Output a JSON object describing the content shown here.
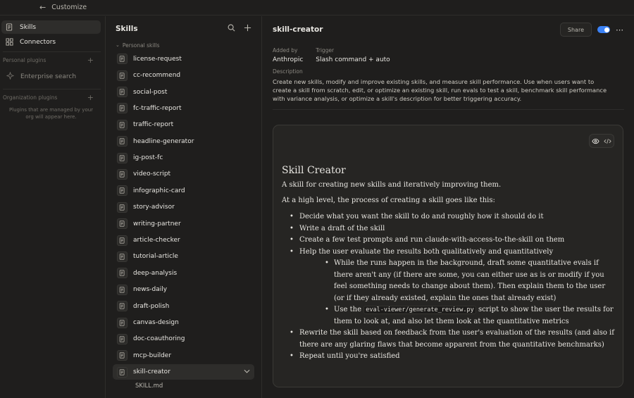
{
  "topbar": {
    "back_icon": "arrow-left-icon",
    "title": "Customize"
  },
  "leftnav": {
    "items": [
      {
        "label": "Skills",
        "icon": "skill-icon",
        "active": true
      },
      {
        "label": "Connectors",
        "icon": "connector-icon",
        "active": false
      }
    ],
    "personal_plugins": "Personal plugins",
    "enterprise_search": "Enterprise search",
    "organization_plugins": "Organization plugins",
    "org_note": "Plugins that are managed by your org will appear here."
  },
  "skills": {
    "title": "Skills",
    "section": "Personal skills",
    "items": [
      "license-request",
      "cc-recommend",
      "social-post",
      "fc-traffic-report",
      "traffic-report",
      "headline-generator",
      "ig-post-fc",
      "video-script",
      "infographic-card",
      "story-advisor",
      "writing-partner",
      "article-checker",
      "tutorial-article",
      "deep-analysis",
      "news-daily",
      "draft-polish",
      "canvas-design",
      "doc-coauthoring",
      "mcp-builder",
      "skill-creator"
    ],
    "active_item": "skill-creator",
    "file": "SKILL.md"
  },
  "detail": {
    "name": "skill-creator",
    "share_label": "Share",
    "toggle_on": true,
    "added_by_label": "Added by",
    "added_by": "Anthropic",
    "trigger_label": "Trigger",
    "trigger": "Slash command + auto",
    "description_label": "Description",
    "description": "Create new skills, modify and improve existing skills, and measure skill performance. Use when users want to create a skill from scratch, edit, or optimize an existing skill, run evals to test a skill, benchmark skill performance with variance analysis, or optimize a skill's description for better triggering accuracy.",
    "doc": {
      "heading": "Skill Creator",
      "intro": "A skill for creating new skills and iteratively improving them.",
      "lead": "At a high level, the process of creating a skill goes like this:",
      "b1": "Decide what you want the skill to do and roughly how it should do it",
      "b2": "Write a draft of the skill",
      "b3": "Create a few test prompts and run claude-with-access-to-the-skill on them",
      "b4": "Help the user evaluate the results both qualitatively and quantitatively",
      "b4a": "While the runs happen in the background, draft some quantitative evals if there aren't any (if there are some, you can either use as is or modify if you feel something needs to change about them). Then explain them to the user (or if they already existed, explain the ones that already exist)",
      "b4b_pre": "Use the",
      "b4b_code": "eval-viewer/generate_review.py",
      "b4b_post": "script to show the user the results for them to look at, and also let them look at the quantitative metrics",
      "b5": "Rewrite the skill based on feedback from the user's evaluation of the results (and also if there are any glaring flaws that become apparent from the quantitative benchmarks)",
      "b6": "Repeat until you're satisfied"
    }
  },
  "colors": {
    "accent": "#3b82f6",
    "background": "#1f1e1d",
    "card": "#262523"
  }
}
